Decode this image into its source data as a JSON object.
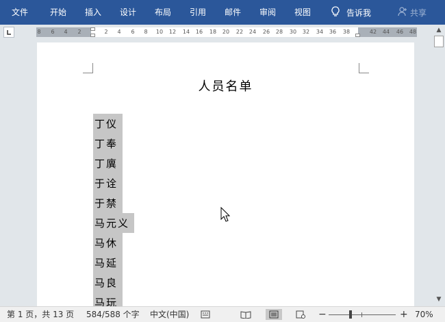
{
  "ribbon": {
    "tabs": [
      "文件",
      "开始",
      "插入",
      "设计",
      "布局",
      "引用",
      "邮件",
      "审阅",
      "视图"
    ],
    "tell_me": "告诉我",
    "share": "共享",
    "colors": {
      "ribbon_bg": "#2b579a",
      "text": "#ffffff"
    }
  },
  "ruler": {
    "left_numbers": [
      "8",
      "6",
      "4",
      "2"
    ],
    "right_numbers": [
      "2",
      "4",
      "6",
      "8",
      "10",
      "12",
      "14",
      "16",
      "18",
      "20",
      "22",
      "24",
      "26",
      "28",
      "30",
      "32",
      "34",
      "36",
      "38"
    ],
    "far_right_numbers": [
      "42",
      "44",
      "46",
      "48"
    ]
  },
  "document": {
    "title": "人员名单",
    "names": [
      "丁仪",
      "丁奉",
      "丁廙",
      "于诠",
      "于禁",
      "马元义",
      "马休",
      "马延",
      "马良",
      "马玩"
    ]
  },
  "status": {
    "page": "第 1 页，共 13 页",
    "words": "584/588 个字",
    "language": "中文(中国)",
    "zoom": "70%",
    "zoom_minus": "−",
    "zoom_plus": "+"
  }
}
